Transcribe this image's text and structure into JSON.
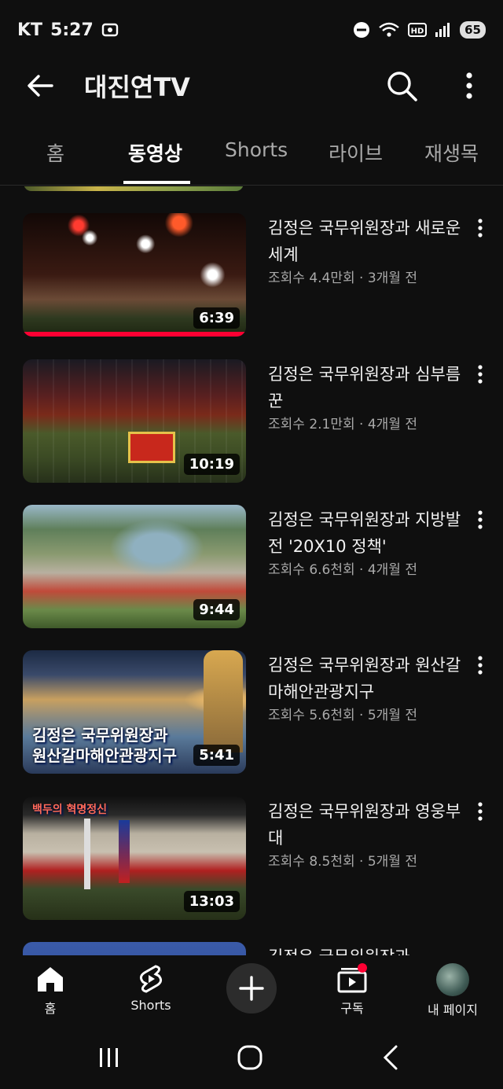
{
  "status": {
    "carrier": "KT",
    "time": "5:27",
    "battery": "65"
  },
  "header": {
    "title": "대진연TV"
  },
  "tabs": [
    "홈",
    "동영상",
    "Shorts",
    "라이브",
    "재생목"
  ],
  "videos": [
    {
      "title": "김정은 국무위원장과 새로운 세계",
      "meta": "조회수 4.4만회 · 3개월 전",
      "duration": "6:39",
      "overlay": ""
    },
    {
      "title": "김정은 국무위원장과 심부름꾼",
      "meta": "조회수 2.1만회 · 4개월 전",
      "duration": "10:19",
      "overlay": ""
    },
    {
      "title": "김정은 국무위원장과 지방발전 '20X10 정책'",
      "meta": "조회수 6.6천회 · 4개월 전",
      "duration": "9:44",
      "overlay": ""
    },
    {
      "title": "김정은 국무위원장과 원산갈마해안관광지구",
      "meta": "조회수 5.6천회 · 5개월 전",
      "duration": "5:41",
      "overlay": "김정은 국무위원장과",
      "overlay2": "원산갈마해안관광지구"
    },
    {
      "title": "김정은 국무위원장과 영웅부대",
      "meta": "조회수 8.5천회 · 5개월 전",
      "duration": "13:03",
      "overlay": "백두의 혁명정신"
    },
    {
      "title": "김정은 국무위원장과",
      "meta": "",
      "duration": "",
      "overlay": ""
    }
  ],
  "bottom_nav": {
    "home": "홈",
    "shorts": "Shorts",
    "subscriptions": "구독",
    "me": "내 페이지"
  },
  "icons": [
    "back-arrow-icon",
    "search-icon",
    "more-vert-icon",
    "home-icon",
    "shorts-icon",
    "plus-icon",
    "subscriptions-icon",
    "avatar",
    "recents-icon",
    "home-circle-icon",
    "back-chevron-icon"
  ],
  "colors": {
    "background": "#0f0f0f",
    "text": "#f1f1f1",
    "secondary": "#aaaaaa",
    "notification": "#ff0033"
  }
}
